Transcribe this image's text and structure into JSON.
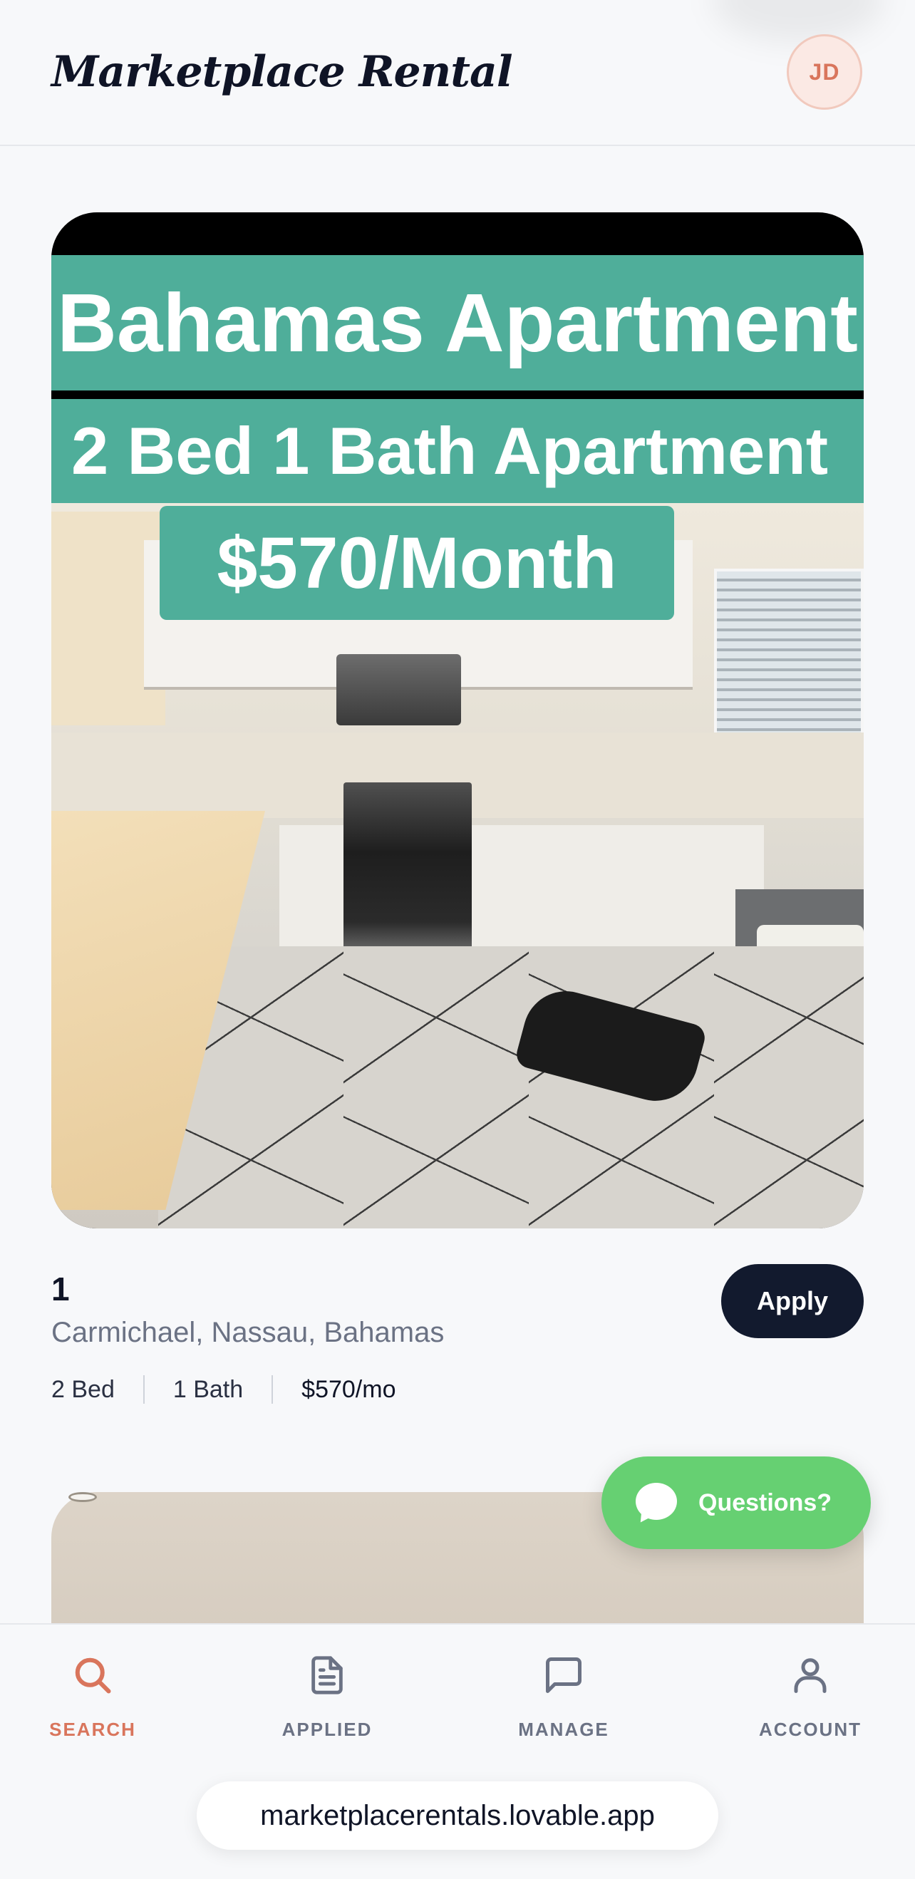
{
  "header": {
    "title": "Marketplace Rental",
    "avatar_initials": "JD"
  },
  "listing": {
    "image": {
      "banner_title": "Bahamas Apartment",
      "banner_subtitle": "2 Bed 1 Bath Apartment",
      "banner_price": "$570/Month"
    },
    "number": "1",
    "location": "Carmichael, Nassau, Bahamas",
    "beds": "2 Bed",
    "baths": "1 Bath",
    "price": "$570/mo",
    "apply_label": "Apply"
  },
  "questions": {
    "label": "Questions?"
  },
  "bottom_nav": {
    "items": [
      {
        "label": "SEARCH",
        "icon": "search-icon",
        "active": true
      },
      {
        "label": "APPLIED",
        "icon": "document-icon",
        "active": false
      },
      {
        "label": "MANAGE",
        "icon": "message-square-icon",
        "active": false
      },
      {
        "label": "ACCOUNT",
        "icon": "user-icon",
        "active": false
      }
    ]
  },
  "browser": {
    "url": "marketplacerentals.lovable.app"
  },
  "colors": {
    "accent": "#d9755c",
    "primary": "#121a2e",
    "banner_teal": "#4fae9a",
    "questions_green": "#66d072"
  }
}
